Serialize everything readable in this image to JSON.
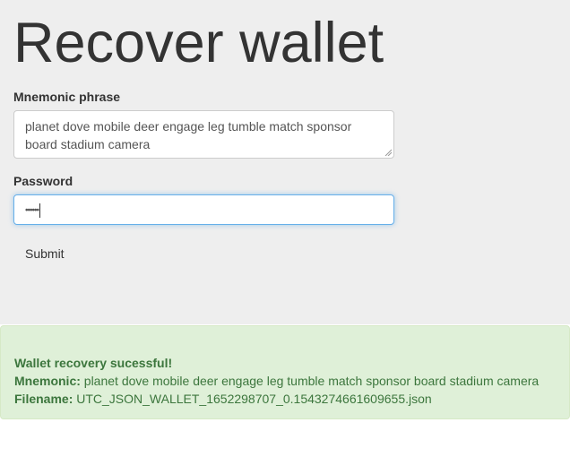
{
  "page": {
    "title": "Recover wallet"
  },
  "form": {
    "mnemonic_label": "Mnemonic phrase",
    "mnemonic_value": "planet dove mobile deer engage leg tumble match sponsor board stadium camera",
    "password_label": "Password",
    "password_mask": "••••••",
    "submit_label": "Submit"
  },
  "result": {
    "heading": "Wallet recovery sucessful!",
    "mnemonic_key": "Mnemonic:",
    "mnemonic_value": "planet dove mobile deer engage leg tumble match sponsor board stadium camera",
    "filename_key": "Filename:",
    "filename_value": "UTC_JSON_WALLET_1652298707_0.1543274661609655.json"
  },
  "colors": {
    "panel_bg": "#eeeeee",
    "success_bg": "#dff0d8",
    "success_text": "#3c763d",
    "focus_border": "#66afe9"
  },
  "icons": {
    "resize_grip": "resize-grip-icon"
  }
}
